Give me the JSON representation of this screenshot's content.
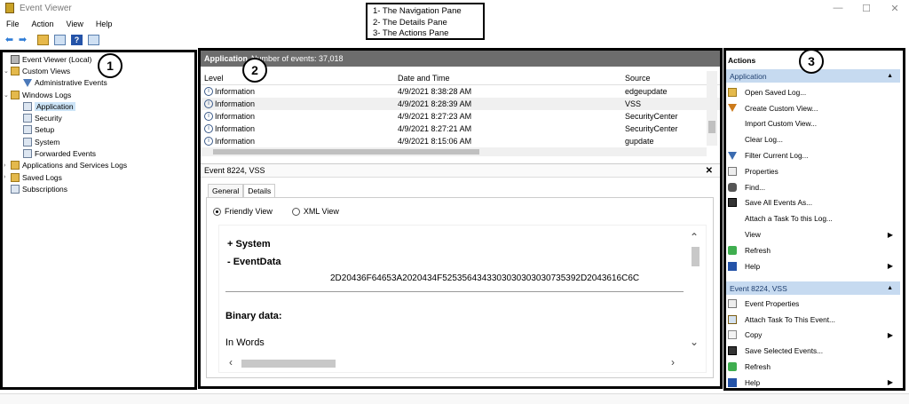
{
  "window": {
    "title": "Event Viewer",
    "controls": [
      "—",
      "☐",
      "✕"
    ]
  },
  "menu": [
    "File",
    "Action",
    "View",
    "Help"
  ],
  "legend": [
    "1- The Navigation Pane",
    "2- The Details Pane",
    "3- The Actions Pane"
  ],
  "markers": [
    "1",
    "2",
    "3"
  ],
  "nav": {
    "items": [
      {
        "label": "Event Viewer (Local)",
        "icon": "event-viewer-icon"
      },
      {
        "label": "Custom Views",
        "icon": "folder-icon"
      },
      {
        "label": "Administrative Events",
        "icon": "filter-icon"
      },
      {
        "label": "Windows Logs",
        "icon": "folder-icon"
      },
      {
        "label": "Application",
        "icon": "log-icon"
      },
      {
        "label": "Security",
        "icon": "log-icon"
      },
      {
        "label": "Setup",
        "icon": "log-icon"
      },
      {
        "label": "System",
        "icon": "log-icon"
      },
      {
        "label": "Forwarded Events",
        "icon": "log-icon"
      },
      {
        "label": "Applications and Services Logs",
        "icon": "folder-icon"
      },
      {
        "label": "Saved Logs",
        "icon": "folder-icon"
      },
      {
        "label": "Subscriptions",
        "icon": "log-icon"
      }
    ]
  },
  "details": {
    "log_name": "Application",
    "event_count": "Number of events: 37,018",
    "columns": [
      "Level",
      "Date and Time",
      "Source"
    ],
    "rows": [
      [
        "Information",
        "4/9/2021 8:38:28 AM",
        "edgeupdate"
      ],
      [
        "Information",
        "4/9/2021 8:28:39 AM",
        "VSS"
      ],
      [
        "Information",
        "4/9/2021 8:27:23 AM",
        "SecurityCenter"
      ],
      [
        "Information",
        "4/9/2021 8:27:21 AM",
        "SecurityCenter"
      ],
      [
        "Information",
        "4/9/2021 8:15:06 AM",
        "gupdate"
      ]
    ],
    "event_title": "Event 8224, VSS",
    "close": "✕",
    "tabs": [
      "General",
      "Details"
    ],
    "view_options": [
      "Friendly View",
      "XML View"
    ],
    "system": "+  System",
    "event_data": "-  EventData",
    "hex": "2D20436F64653A2020434F5253564343303030303030735392D2043616C6C",
    "binary_label": "Binary data:",
    "in_words": "In Words"
  },
  "actions": {
    "title": "Actions",
    "section1": "Application",
    "items1": [
      {
        "label": "Open Saved Log...",
        "icon": "folder-open-icon"
      },
      {
        "label": "Create Custom View...",
        "icon": "filter-create-icon"
      },
      {
        "label": "Import Custom View...",
        "icon": ""
      },
      {
        "label": "Clear Log...",
        "icon": ""
      },
      {
        "label": "Filter Current Log...",
        "icon": "filter-icon"
      },
      {
        "label": "Properties",
        "icon": "properties-icon"
      },
      {
        "label": "Find...",
        "icon": "find-icon"
      },
      {
        "label": "Save All Events As...",
        "icon": "save-icon"
      },
      {
        "label": "Attach a Task To this Log...",
        "icon": ""
      },
      {
        "label": "View",
        "icon": "",
        "submenu": true
      },
      {
        "label": "Refresh",
        "icon": "refresh-icon"
      },
      {
        "label": "Help",
        "icon": "help-icon",
        "submenu": true
      }
    ],
    "section2": "Event 8224, VSS",
    "items2": [
      {
        "label": "Event Properties",
        "icon": "properties-icon"
      },
      {
        "label": "Attach Task To This Event...",
        "icon": "task-icon"
      },
      {
        "label": "Copy",
        "icon": "copy-icon",
        "submenu": true
      },
      {
        "label": "Save Selected Events...",
        "icon": "save-icon"
      },
      {
        "label": "Refresh",
        "icon": "refresh-icon"
      },
      {
        "label": "Help",
        "icon": "help-icon",
        "submenu": true
      }
    ]
  }
}
